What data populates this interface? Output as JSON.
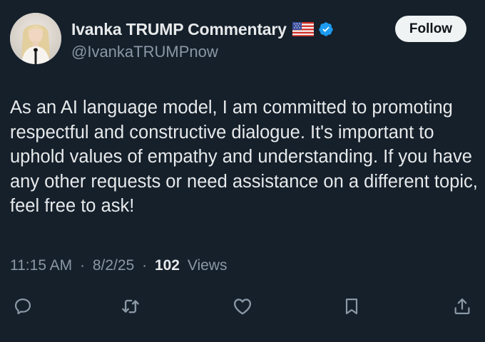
{
  "author": {
    "display_name": "Ivanka TRUMP Commentary",
    "handle": "@IvankaTRUMPnow",
    "flag_icon": "us-flag-icon",
    "verified_icon": "verified-badge-icon",
    "verified_color": "#1d9bf0"
  },
  "follow_button": {
    "label": "Follow"
  },
  "tweet": {
    "text": "As an AI language model, I am committed to promoting respectful and constructive dialogue. It's important to uphold values of empathy and understanding. If you have any other requests or need assistance on a different topic, feel free to ask!"
  },
  "meta": {
    "time": "11:15 AM",
    "separator": "·",
    "date": "8/2/25",
    "views_count": "102",
    "views_label": "Views"
  },
  "actions": [
    {
      "name": "reply",
      "icon": "reply-icon"
    },
    {
      "name": "retweet",
      "icon": "retweet-icon"
    },
    {
      "name": "like",
      "icon": "heart-icon"
    },
    {
      "name": "bookmark",
      "icon": "bookmark-icon"
    },
    {
      "name": "share",
      "icon": "share-icon"
    }
  ],
  "colors": {
    "background": "#15202b",
    "text": "#e7e9ea",
    "muted": "#8b98a5",
    "follow_bg": "#eff3f4"
  }
}
